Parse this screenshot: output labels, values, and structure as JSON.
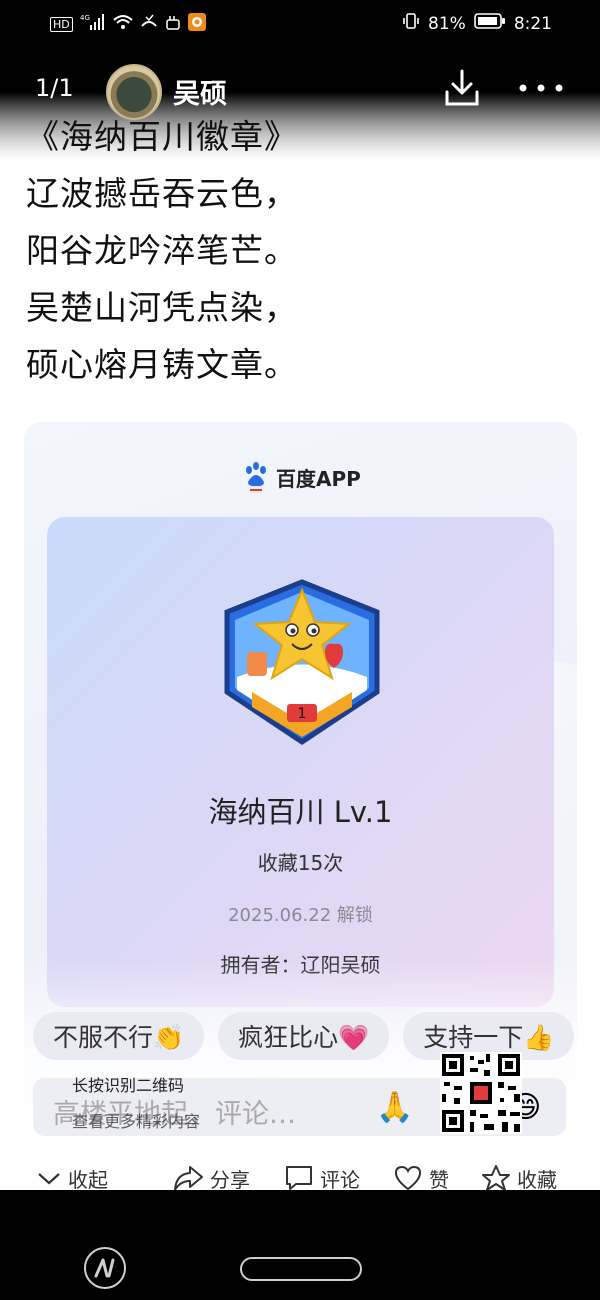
{
  "status_bar": {
    "network": "4G",
    "hd": "HD",
    "battery_percent": "81%",
    "time": "8:21"
  },
  "header": {
    "page_count": "1/1",
    "username": "吴硕"
  },
  "poem": {
    "title": "《海纳百川徽章》",
    "lines": [
      "辽波撼岳吞云色，",
      "阳谷龙吟淬笔芒。",
      "吴楚山河凭点染，",
      "硕心熔月铸文章。"
    ]
  },
  "card": {
    "brand": "百度APP",
    "badge_title": "海纳百川 Lv.1",
    "favorites": "收藏15次",
    "unlock_date": "2025.06.22 解锁",
    "owner": "拥有者：辽阳吴硕",
    "badge_level": "1"
  },
  "quick_replies": [
    {
      "label": "不服不行👏"
    },
    {
      "label": "疯狂比心💗"
    },
    {
      "label": "支持一下👍"
    }
  ],
  "comment": {
    "placeholder": "高楼平地起，评论…",
    "qr_line1": "长按识别二维码",
    "qr_line2": "查看更多精彩内容",
    "emojis": [
      "🙏",
      "🌹",
      "😄"
    ]
  },
  "actions": {
    "collapse": "收起",
    "share": "分享",
    "comment": "评论",
    "like": "赞",
    "favorite": "收藏"
  },
  "colors": {
    "accent_blue": "#2a6de1",
    "badge_red": "#e23b3b",
    "badge_yellow": "#f7c531"
  }
}
